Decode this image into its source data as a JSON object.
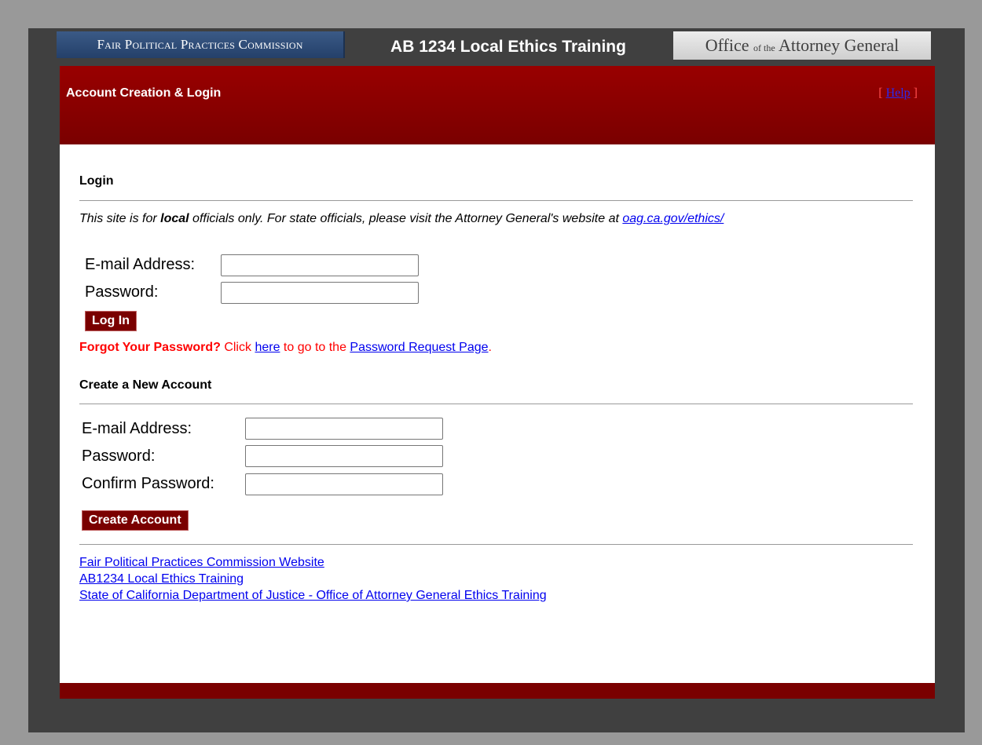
{
  "header": {
    "fppc_logo_text": "Fair Political Practices Commission",
    "site_title": "AB 1234 Local Ethics Training",
    "oag_logo_part1": "Office",
    "oag_logo_small": "of the",
    "oag_logo_part2": "Attorney General"
  },
  "banner": {
    "title": "Account Creation & Login",
    "help_open": "[ ",
    "help_label": "Help",
    "help_close": " ]"
  },
  "login": {
    "heading": "Login",
    "note_pre": "This site is for ",
    "note_bold": "local",
    "note_mid": " officials only. For state officials, please visit the Attorney General's website at ",
    "note_link": "oag.ca.gov/ethics/",
    "email_label": "E-mail Address:",
    "email_value": "",
    "password_label": "Password:",
    "password_value": "",
    "button_label": "Log In",
    "forgot_bold": "Forgot Your Password?",
    "forgot_text1": " Click ",
    "forgot_link1": "here",
    "forgot_text2": " to go to the ",
    "forgot_link2": "Password Request Page",
    "forgot_text3": "."
  },
  "create": {
    "heading": "Create a New Account",
    "email_label": "E-mail Address:",
    "email_value": "",
    "password_label": "Password:",
    "password_value": "",
    "confirm_label": "Confirm Password:",
    "confirm_value": "",
    "button_label": "Create Account"
  },
  "footer_links": [
    "Fair Political Practices Commission Website",
    "AB1234 Local Ethics Training",
    "State of California Department of Justice - Office of Attorney General Ethics Training"
  ],
  "colors": {
    "banner_red": "#7a0000",
    "link_blue": "#0000ee",
    "forgot_red": "#ff0000",
    "frame_dark": "#404040",
    "page_gray": "#999999"
  }
}
